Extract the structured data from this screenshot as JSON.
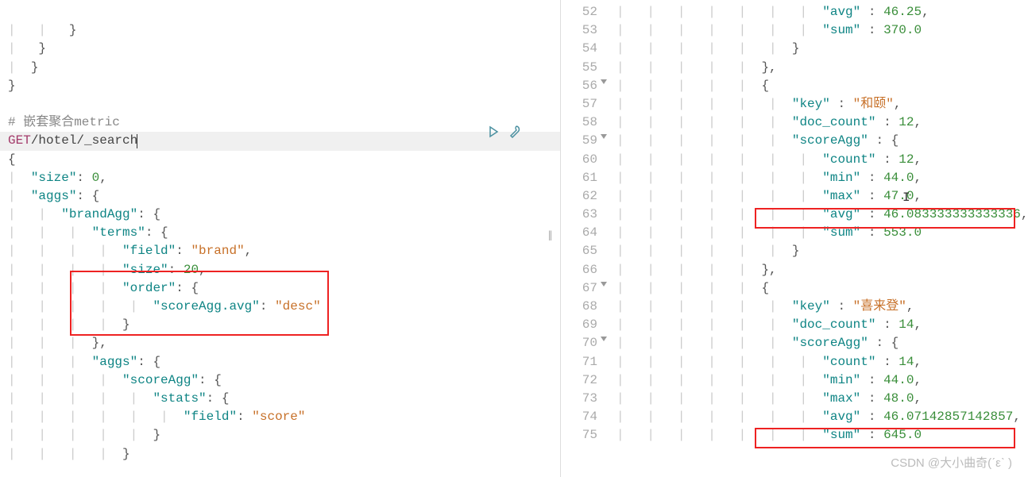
{
  "left": {
    "comment": "# 嵌套聚合metric",
    "method": "GET",
    "url": "/hotel/_search",
    "size_key": "\"size\"",
    "size_val": "0",
    "aggs_key": "\"aggs\"",
    "brandAgg_key": "\"brandAgg\"",
    "terms_key": "\"terms\"",
    "field_key": "\"field\"",
    "brand_val": "\"brand\"",
    "size_inner_key": "\"size\"",
    "size_inner_val": "20",
    "order_key": "\"order\"",
    "scoreAvg_key": "\"scoreAgg.avg\"",
    "desc_val": "\"desc\"",
    "aggs2_key": "\"aggs\"",
    "scoreAgg_key": "\"scoreAgg\"",
    "stats_key": "\"stats\"",
    "field2_key": "\"field\"",
    "score_val": "\"score\""
  },
  "right": {
    "lines": {
      "52": {
        "ln": "52",
        "avg": "\"avg\"",
        "avgv": "46.25"
      },
      "53": {
        "ln": "53",
        "sum": "\"sum\"",
        "sumv": "370.0"
      },
      "54": {
        "ln": "54"
      },
      "55": {
        "ln": "55"
      },
      "56": {
        "ln": "56"
      },
      "57": {
        "ln": "57",
        "key": "\"key\"",
        "keyv": "\"和颐\""
      },
      "58": {
        "ln": "58",
        "doc": "\"doc_count\"",
        "docv": "12"
      },
      "59": {
        "ln": "59",
        "sa": "\"scoreAgg\""
      },
      "60": {
        "ln": "60",
        "cnt": "\"count\"",
        "cntv": "12"
      },
      "61": {
        "ln": "61",
        "min": "\"min\"",
        "minv": "44.0"
      },
      "62": {
        "ln": "62",
        "max": "\"max\"",
        "maxv": "47.0"
      },
      "63": {
        "ln": "63",
        "avg": "\"avg\"",
        "avgv": "46.083333333333336"
      },
      "64": {
        "ln": "64",
        "sum": "\"sum\"",
        "sumv": "553.0"
      },
      "65": {
        "ln": "65"
      },
      "66": {
        "ln": "66"
      },
      "67": {
        "ln": "67"
      },
      "68": {
        "ln": "68",
        "key": "\"key\"",
        "keyv": "\"喜来登\""
      },
      "69": {
        "ln": "69",
        "doc": "\"doc_count\"",
        "docv": "14"
      },
      "70": {
        "ln": "70",
        "sa": "\"scoreAgg\""
      },
      "71": {
        "ln": "71",
        "cnt": "\"count\"",
        "cntv": "14"
      },
      "72": {
        "ln": "72",
        "min": "\"min\"",
        "minv": "44.0"
      },
      "73": {
        "ln": "73",
        "max": "\"max\"",
        "maxv": "48.0"
      },
      "74": {
        "ln": "74",
        "avg": "\"avg\"",
        "avgv": "46.07142857142857"
      },
      "75": {
        "ln": "75",
        "sum": "\"sum\"",
        "sumv": "645.0"
      }
    }
  },
  "watermark": "CSDN @大小曲奇(ˊεˋ )"
}
